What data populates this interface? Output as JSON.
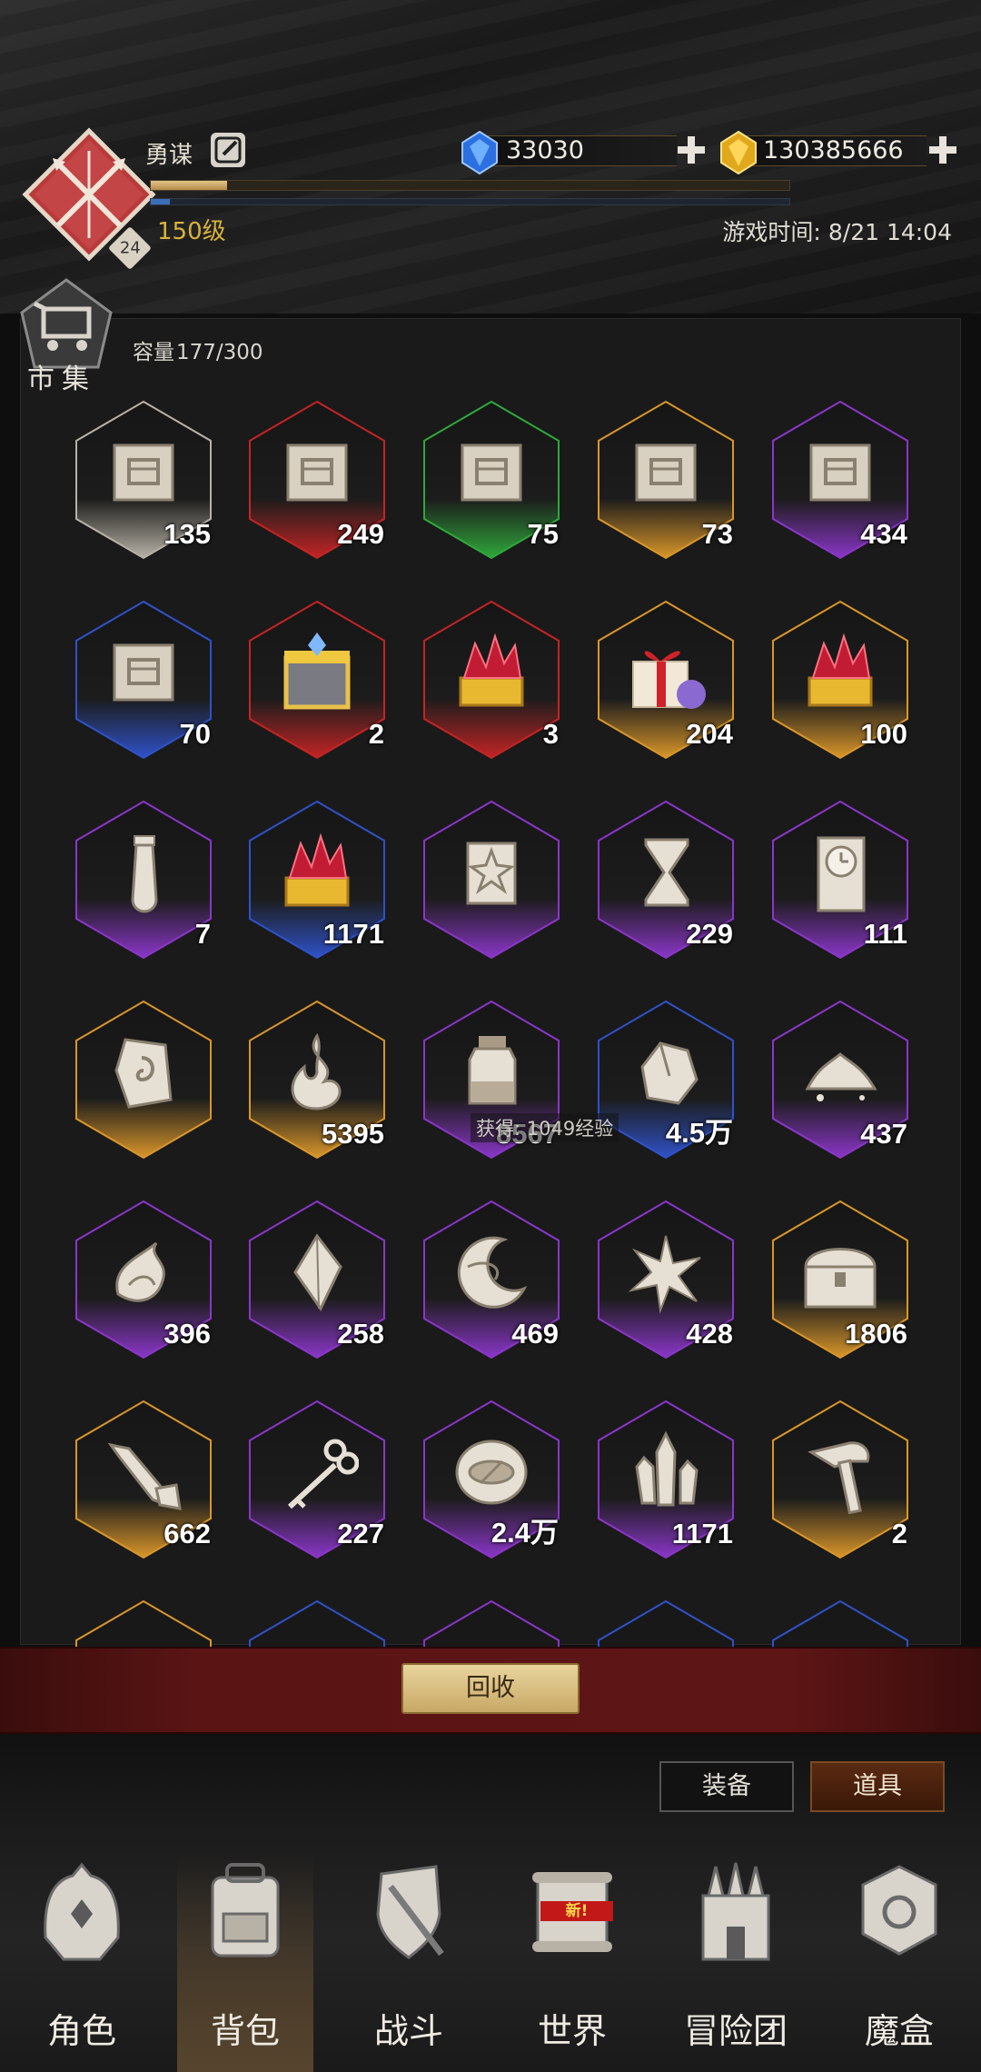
{
  "player": {
    "name": "勇谋",
    "level_label": "150级",
    "avatar_badge": "24",
    "xp_progress": 0.12,
    "xp2_progress": 0.03,
    "avatar_icon": "crossed-swords-icon"
  },
  "currency": {
    "gems": "33030",
    "gold": "130385666",
    "gem_icon": "blue-crystal-icon",
    "gold_icon": "gold-crystal-icon"
  },
  "game_time": {
    "label": "游戏时间:",
    "value": "8/21 14:04"
  },
  "market": {
    "label": "市集",
    "capacity_label": "容量",
    "capacity_value": "177/300"
  },
  "items": [
    {
      "icon": "map-chest-icon",
      "count": "135",
      "rarity": "white"
    },
    {
      "icon": "map-chest-icon",
      "count": "249",
      "rarity": "red"
    },
    {
      "icon": "map-chest-icon",
      "count": "75",
      "rarity": "green"
    },
    {
      "icon": "map-chest-icon",
      "count": "73",
      "rarity": "orange"
    },
    {
      "icon": "map-chest-icon",
      "count": "434",
      "rarity": "purple"
    },
    {
      "icon": "map-chest-icon",
      "count": "70",
      "rarity": "blue"
    },
    {
      "icon": "gold-box-icon",
      "count": "2",
      "rarity": "red"
    },
    {
      "icon": "ruby-chest-icon",
      "count": "3",
      "rarity": "red"
    },
    {
      "icon": "gift-box-icon",
      "count": "204",
      "rarity": "orange"
    },
    {
      "icon": "ruby-chest-icon",
      "count": "100",
      "rarity": "orange"
    },
    {
      "icon": "vial-icon",
      "count": "7",
      "rarity": "purple"
    },
    {
      "icon": "ruby-chest-icon",
      "count": "1171",
      "rarity": "blue"
    },
    {
      "icon": "scroll-icon",
      "count": "",
      "rarity": "purple"
    },
    {
      "icon": "hourglass-icon",
      "count": "229",
      "rarity": "purple"
    },
    {
      "icon": "clock-icon",
      "count": "111",
      "rarity": "purple"
    },
    {
      "icon": "rune-stone-icon",
      "count": "",
      "rarity": "orange"
    },
    {
      "icon": "flame-icon",
      "count": "5395",
      "rarity": "orange"
    },
    {
      "icon": "jar-icon",
      "count": "8567",
      "rarity": "purple"
    },
    {
      "icon": "ore-icon",
      "count": "4.5万",
      "rarity": "blue"
    },
    {
      "icon": "dust-icon",
      "count": "437",
      "rarity": "purple"
    },
    {
      "icon": "fire-claw-icon",
      "count": "396",
      "rarity": "purple"
    },
    {
      "icon": "shard-icon",
      "count": "258",
      "rarity": "purple"
    },
    {
      "icon": "moon-icon",
      "count": "469",
      "rarity": "purple"
    },
    {
      "icon": "burst-icon",
      "count": "428",
      "rarity": "purple"
    },
    {
      "icon": "treasure-chest-icon",
      "count": "1806",
      "rarity": "orange"
    },
    {
      "icon": "crystal-sword-icon",
      "count": "662",
      "rarity": "orange"
    },
    {
      "icon": "key-icon",
      "count": "227",
      "rarity": "purple"
    },
    {
      "icon": "eye-icon",
      "count": "2.4万",
      "rarity": "purple"
    },
    {
      "icon": "crystals-icon",
      "count": "1171",
      "rarity": "purple"
    },
    {
      "icon": "hammer-icon",
      "count": "2",
      "rarity": "orange"
    }
  ],
  "tooltip": "获得: 1049经验",
  "recycle_label": "回收",
  "filter_tabs": {
    "equipment": "装备",
    "items": "道具"
  },
  "nav": [
    {
      "label": "角色",
      "icon": "helmet-icon"
    },
    {
      "label": "背包",
      "icon": "backpack-icon"
    },
    {
      "label": "战斗",
      "icon": "shield-sword-icon"
    },
    {
      "label": "世界",
      "icon": "scroll-map-icon",
      "badge": "新!"
    },
    {
      "label": "冒险团",
      "icon": "castle-icon"
    },
    {
      "label": "魔盒",
      "icon": "magic-cube-icon"
    }
  ],
  "colors": {
    "white": "#b8b2a6",
    "red": "#c42424",
    "green": "#2fa83a",
    "orange": "#d9962a",
    "purple": "#8a36c8",
    "blue": "#2f52c8",
    "gold_text": "#d9b23d"
  }
}
